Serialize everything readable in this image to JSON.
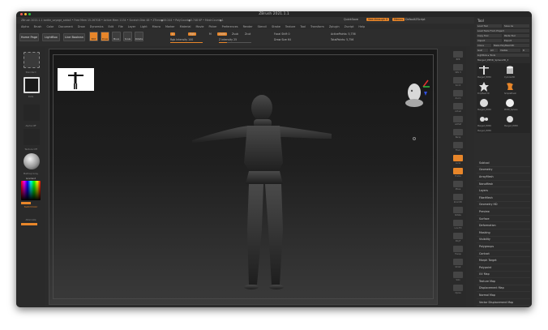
{
  "window": {
    "title": "ZBrush 2021.1.1",
    "colors": {
      "accent": "#e8862a",
      "close": "#ff5f57",
      "minimize": "#febc2e",
      "zoom": "#28c840"
    }
  },
  "infobar": {
    "text": "ZBrush 2021.1.1  bottle_voyage_addall  • Free Mem 15.267GB • Active Mem 1134 • Scratch Disk 48 • ZTime●00:244 • PolyCount●5.748 KP • MeshCount●1",
    "quicksave": "QuickSave",
    "see_through": "See-through  0",
    "menus_toggle": "Menus",
    "default_script": "DefaultZScript"
  },
  "menubar": [
    "Alpha",
    "Brush",
    "Color",
    "Document",
    "Draw",
    "Dynamics",
    "Edit",
    "File",
    "Layer",
    "Light",
    "Macro",
    "Marker",
    "Material",
    "Movie",
    "Picker",
    "Preferences",
    "Render",
    "Stencil",
    "Stroke",
    "Texture",
    "Tool",
    "Transform",
    "Zplugin",
    "Zscript",
    "Help"
  ],
  "toolbar": {
    "tabs": [
      "Home Page",
      "LightBox",
      "Live Boolean"
    ],
    "buttons": [
      "Edit",
      "Draw",
      "Move",
      "Scale",
      "Rotate"
    ],
    "mrgb": "A",
    "rgb": "Rgb",
    "m": "M",
    "zadd": "Zadd",
    "zsub": "Zsub",
    "zcut": "Zcut",
    "rgb_intensity": "Rgb Intensity 100",
    "z_intensity": "Z Intensity 25",
    "rgb_intensity_level": 1.0,
    "z_intensity_level": 0.25,
    "focal_shift": "Focal Shift 0",
    "draw_size": "Draw Size 64",
    "active_points": "ActivePoints: 5,756",
    "total_points": "TotalPoints: 5,756"
  },
  "leftshelf": {
    "labels": [
      "Standard",
      "Dots",
      "Alpha Off",
      "Texture Off",
      "MatCap Gray",
      "Gradient",
      "SwitchColor",
      "Alternate"
    ]
  },
  "rightshelf": {
    "labels": [
      "BPR",
      "SPix 3",
      "Scroll",
      "Zoom",
      "Actual",
      "AAHalf",
      "Persp",
      "Floor",
      "Local",
      "Frame",
      "Move",
      "Zoom3D",
      "Rotate",
      "Line Fill",
      "PolyF",
      "Transp",
      "Ghost",
      "Solo",
      "Xpose"
    ]
  },
  "tool_panel": {
    "title": "Tool",
    "buttons": [
      "Load Tool",
      "Save As",
      "Load Tools From Project",
      "Copy Tool",
      "Paste Tool",
      "Import",
      "Export",
      "Clone",
      "Make PolyMesh3D",
      "GoZ",
      "All",
      "Visible",
      "R",
      "Lightbox ▸ Tools"
    ],
    "current_tool": "Merged_PM3D_Sphere3D_3",
    "tools": [
      "Merged_PM3D",
      "Cylinder3D",
      "PolyMesh3D",
      "SimpleBrush",
      "Merged_PM3D",
      "PM3D_Sphere",
      "Merged_PM3D",
      "Merged_PM3D",
      "Merged_PM3D"
    ],
    "subpalettes": [
      "Subtool",
      "Geometry",
      "ArrayMesh",
      "NanoMesh",
      "Layers",
      "FiberMesh",
      "Geometry HD",
      "Preview",
      "Surface",
      "Deformation",
      "Masking",
      "Visibility",
      "Polygroups",
      "Contact",
      "Morph Target",
      "Polypaint",
      "UV Map",
      "Texture Map",
      "Displacement Map",
      "Normal Map",
      "Vector Displacement Map",
      "Display Properties",
      "Unified Skin"
    ]
  }
}
